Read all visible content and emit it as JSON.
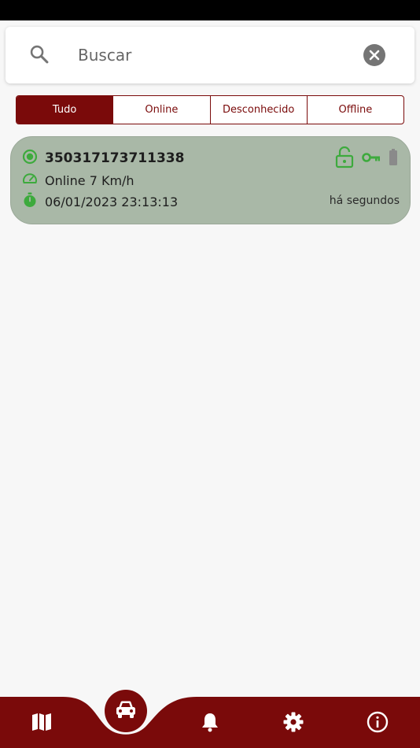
{
  "search": {
    "placeholder": "Buscar",
    "value": ""
  },
  "tabs": [
    {
      "label": "Tudo",
      "active": true
    },
    {
      "label": "Online",
      "active": false
    },
    {
      "label": "Desconhecido",
      "active": false
    },
    {
      "label": "Offline",
      "active": false
    }
  ],
  "device": {
    "id": "35031717371133 8",
    "status": "Online 7 Km/h",
    "datetime": "06/01/2023 23:13:13",
    "ago": "há segundos",
    "icons": [
      "lock-open-icon",
      "key-icon",
      "battery-icon"
    ]
  },
  "nav": {
    "items": [
      "map-icon",
      "car-icon",
      "bell-icon",
      "gear-icon",
      "info-icon"
    ],
    "active": "car-icon"
  },
  "colors": {
    "brand": "#7a0a0a",
    "card_bg": "#a9b8a7",
    "online_green": "#3daa3d",
    "icon_gray": "#757575"
  }
}
